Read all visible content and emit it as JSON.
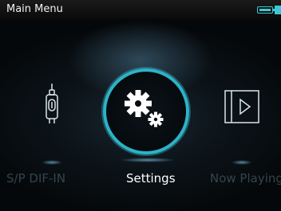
{
  "status_bar": {
    "title": "Main Menu",
    "battery_icon": "battery-icon",
    "accent_color": "#3fc6d6"
  },
  "menu": {
    "items": [
      {
        "label": "S/P DIF-IN",
        "icon": "spdif-connector-icon",
        "selected": false
      },
      {
        "label": "Settings",
        "icon": "gears-icon",
        "selected": true
      },
      {
        "label": "Now Playing",
        "icon": "play-icon",
        "selected": false
      }
    ]
  }
}
